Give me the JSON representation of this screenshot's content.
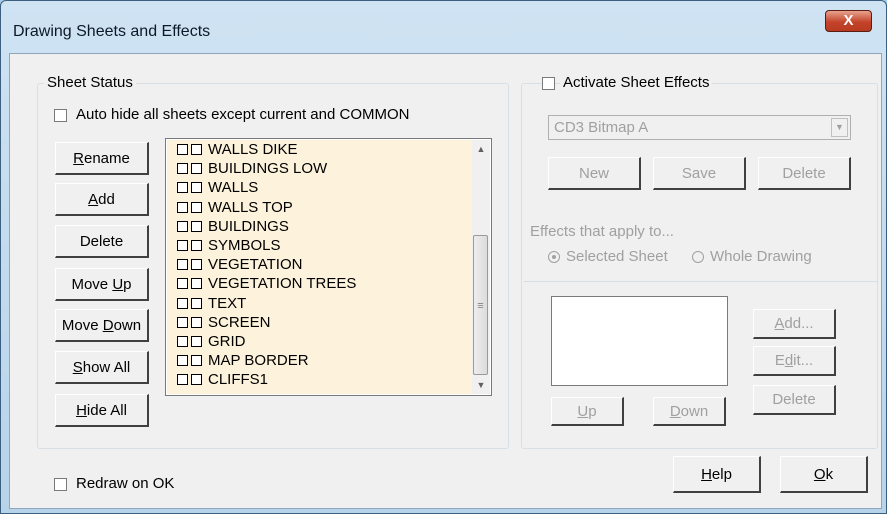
{
  "window": {
    "title": "Drawing Sheets and Effects",
    "close_glyph": "X"
  },
  "sheet_status": {
    "legend": "Sheet Status",
    "auto_hide": {
      "label": "Auto hide all sheets except current and COMMON",
      "checked": false
    },
    "buttons": {
      "rename": {
        "accel": "R",
        "rest": "ename"
      },
      "add": {
        "accel": "A",
        "rest": "dd"
      },
      "delete": {
        "label": "Delete"
      },
      "move_up": {
        "pre": "Move ",
        "accel": "U",
        "rest": "p"
      },
      "move_down": {
        "pre": "Move ",
        "accel": "D",
        "rest": "own"
      },
      "show_all": {
        "accel": "S",
        "rest": "how All"
      },
      "hide_all": {
        "accel": "H",
        "rest": "ide All"
      }
    },
    "sheets": [
      "WALLS DIKE",
      "BUILDINGS LOW",
      "WALLS",
      "WALLS TOP",
      "BUILDINGS",
      "SYMBOLS",
      "VEGETATION",
      "VEGETATION TREES",
      "TEXT",
      "SCREEN",
      "GRID",
      "MAP BORDER",
      "CLIFFS1"
    ]
  },
  "sheet_effects": {
    "activate": {
      "label": "Activate Sheet Effects",
      "checked": false
    },
    "effect_select": {
      "value": "CD3 Bitmap A"
    },
    "buttons": {
      "new": "New",
      "save": "Save",
      "delete": "Delete"
    },
    "applies_to": {
      "legend": "Effects that apply to...",
      "selected_sheet": "Selected Sheet",
      "whole_drawing": "Whole Drawing",
      "selected": "selected_sheet"
    },
    "effect_buttons": {
      "add": {
        "accel": "A",
        "rest": "dd..."
      },
      "edit": {
        "pre": "E",
        "accel": "d",
        "rest": "it..."
      },
      "delete": "Delete",
      "up": {
        "accel": "U",
        "rest": "p"
      },
      "down": {
        "accel": "D",
        "rest": "own"
      }
    }
  },
  "footer": {
    "redraw_on_ok": {
      "label": "Redraw on OK",
      "checked": false
    },
    "help": {
      "accel": "H",
      "rest": "elp"
    },
    "ok": {
      "accel": "O",
      "rest": "k"
    }
  },
  "colors": {
    "list_background": "#fdf3dc",
    "dialog_face": "#f0f0f0",
    "close_button": "#c4442a"
  }
}
